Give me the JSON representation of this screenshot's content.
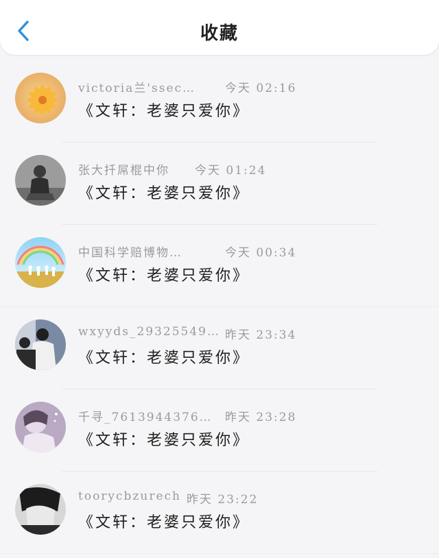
{
  "header": {
    "title": "收藏"
  },
  "items": [
    {
      "name": "victoria兰'ssec…",
      "time": "今天 02:16",
      "message": "《文轩：老婆只爱你》"
    },
    {
      "name": "张大扦屌棍中你",
      "time": "今天 01:24",
      "message": "《文轩：老婆只爱你》"
    },
    {
      "name": "中国科学赔博物…",
      "time": "今天 00:34",
      "message": "《文轩：老婆只爱你》"
    },
    {
      "name": "wxyyds_29325549…",
      "time": "昨天 23:34",
      "message": "《文轩：老婆只爱你》"
    },
    {
      "name": "千寻_7613944376…",
      "time": "昨天 23:28",
      "message": "《文轩：老婆只爱你》"
    },
    {
      "name": "toorycbzurech",
      "time": "昨天 23:22",
      "message": "《文轩：老婆只爱你》"
    }
  ],
  "icons": {
    "back": "chevron-left-icon"
  },
  "colors": {
    "accent": "#2f8fdc",
    "name_text": "#9a9a9a",
    "message_text": "#1e1e1e"
  }
}
